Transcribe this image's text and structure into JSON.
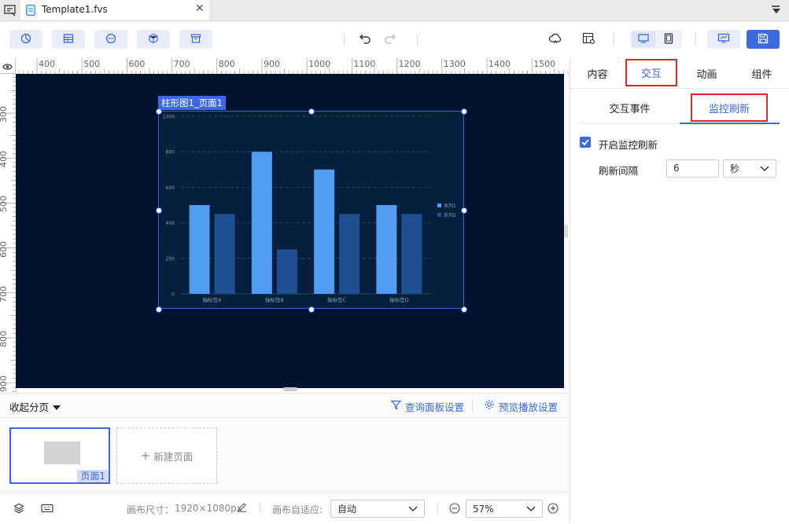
{
  "tab": {
    "file_name": "Template1.fvs"
  },
  "toolbar": {
    "left_icons": [
      "pie-chart-icon",
      "table-icon",
      "more-circle-icon",
      "cube-icon",
      "archive-icon"
    ],
    "right_icons": [
      "cloud-icon",
      "grid-settings-icon",
      "desktop-icon",
      "tablet-icon",
      "presentation-icon",
      "save-icon"
    ]
  },
  "ruler": {
    "top_labels": [
      "400",
      "500",
      "600",
      "700",
      "800",
      "900",
      "1000",
      "1100",
      "1200",
      "1300",
      "1400",
      "1500"
    ],
    "left_labels": [
      "300",
      "400",
      "500",
      "600",
      "700",
      "800",
      "900"
    ]
  },
  "chart": {
    "tag": "柱形图1_页面1",
    "legend": [
      "系列1",
      "系列2"
    ]
  },
  "chart_data": {
    "type": "bar",
    "categories": [
      "轴标签A",
      "轴标签B",
      "轴标签C",
      "轴标签D"
    ],
    "series": [
      {
        "name": "系列1",
        "values": [
          500,
          800,
          700,
          500
        ],
        "color": "#4f9cf0"
      },
      {
        "name": "系列2",
        "values": [
          450,
          250,
          450,
          450
        ],
        "color": "#1e4f92"
      }
    ],
    "yticks": [
      0,
      200,
      400,
      600,
      800,
      1000
    ],
    "ylim": [
      0,
      1000
    ],
    "grid": true,
    "legend_position": "right"
  },
  "panel": {
    "tabs": [
      "内容",
      "交互",
      "动画",
      "组件"
    ],
    "active_tab": "交互",
    "subtabs": [
      "交互事件",
      "监控刷新"
    ],
    "active_subtab": "监控刷新",
    "enable_label": "开启监控刷新",
    "enable_checked": true,
    "interval_label": "刷新间隔",
    "interval_value": "6",
    "interval_unit": "秒",
    "accent_color": "#3d69e0",
    "highlight_color": "#e0262b"
  },
  "pages": {
    "collapse_label": "收起分页",
    "query_panel_label": "查询面板设置",
    "preview_label": "预览播放设置",
    "page1_label": "页面1",
    "new_page_label": "新建页面"
  },
  "status": {
    "canvas_size_label": "画布尺寸：",
    "canvas_size_value": "1920×1080px",
    "fit_label": "画布自适应:",
    "fit_value": "自动",
    "zoom_value": "57%"
  }
}
